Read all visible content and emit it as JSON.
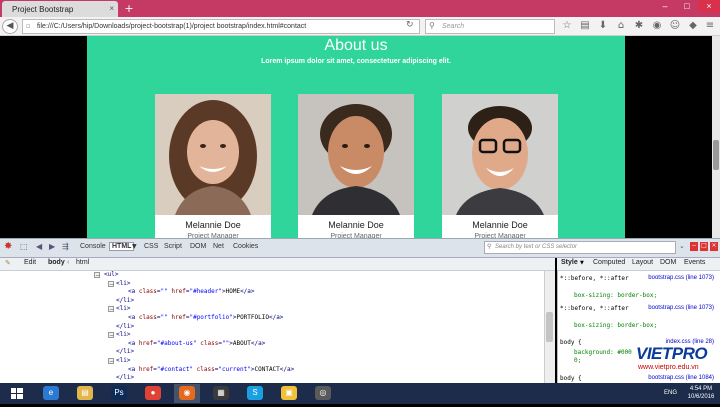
{
  "browser": {
    "tab_title": "Project Bootstrap",
    "tab_close": "×",
    "new_tab": "+",
    "url": "file:///C:/Users/hip/Downloads/project-bootstrap(1)/project bootstrap/index.html#contact",
    "search_placeholder": "Search",
    "window_buttons": [
      "–",
      "□",
      "×"
    ]
  },
  "page": {
    "title": "About us",
    "subtitle": "Lorem ipsum dolor sit amet, consectetuer adipiscing elit.",
    "team": [
      {
        "name": "Melannie Doe",
        "role": "Project Manager"
      },
      {
        "name": "Melannie Doe",
        "role": "Project Manager"
      },
      {
        "name": "Melannie Doe",
        "role": "Project Manager"
      }
    ]
  },
  "firebug": {
    "tabs": [
      "Console",
      "HTML",
      "CSS",
      "Script",
      "DOM",
      "Net",
      "Cookies"
    ],
    "active_tab": "HTML",
    "search_placeholder": "Search by text or CSS selector",
    "edit_label": "Edit",
    "breadcrumb": [
      "body",
      "html"
    ],
    "side_tabs": [
      "Style",
      "Computed",
      "Layout",
      "DOM",
      "Events"
    ],
    "html_lines": [
      {
        "indent": 0,
        "expander": "−",
        "parts": [
          [
            "tag",
            "<ul>"
          ]
        ]
      },
      {
        "indent": 1,
        "expander": "−",
        "parts": [
          [
            "tag",
            "<li>"
          ]
        ]
      },
      {
        "indent": 2,
        "expander": "",
        "parts": [
          [
            "tag",
            "<a "
          ],
          [
            "attr",
            "class"
          ],
          [
            "tag",
            "="
          ],
          [
            "val",
            "\"\""
          ],
          [
            "tag",
            " "
          ],
          [
            "attr",
            "href"
          ],
          [
            "tag",
            "="
          ],
          [
            "val",
            "\"#header\""
          ],
          [
            "tag",
            ">"
          ],
          [
            "txt",
            "HOME"
          ],
          [
            "tag",
            "</a>"
          ]
        ]
      },
      {
        "indent": 1,
        "expander": "",
        "parts": [
          [
            "tag",
            "</li>"
          ]
        ]
      },
      {
        "indent": 1,
        "expander": "−",
        "parts": [
          [
            "tag",
            "<li>"
          ]
        ]
      },
      {
        "indent": 2,
        "expander": "",
        "parts": [
          [
            "tag",
            "<a "
          ],
          [
            "attr",
            "class"
          ],
          [
            "tag",
            "="
          ],
          [
            "val",
            "\"\""
          ],
          [
            "tag",
            " "
          ],
          [
            "attr",
            "href"
          ],
          [
            "tag",
            "="
          ],
          [
            "val",
            "\"#portfolio\""
          ],
          [
            "tag",
            ">"
          ],
          [
            "txt",
            "PORTFOLIO"
          ],
          [
            "tag",
            "</a>"
          ]
        ]
      },
      {
        "indent": 1,
        "expander": "",
        "parts": [
          [
            "tag",
            "</li>"
          ]
        ]
      },
      {
        "indent": 1,
        "expander": "−",
        "parts": [
          [
            "tag",
            "<li>"
          ]
        ]
      },
      {
        "indent": 2,
        "expander": "",
        "parts": [
          [
            "tag",
            "<a "
          ],
          [
            "attr",
            "href"
          ],
          [
            "tag",
            "="
          ],
          [
            "val",
            "\"#about-us\""
          ],
          [
            "tag",
            " "
          ],
          [
            "attr",
            "class"
          ],
          [
            "tag",
            "="
          ],
          [
            "val",
            "\"\""
          ],
          [
            "tag",
            ">"
          ],
          [
            "txt",
            "ABOUT"
          ],
          [
            "tag",
            "</a>"
          ]
        ]
      },
      {
        "indent": 1,
        "expander": "",
        "parts": [
          [
            "tag",
            "</li>"
          ]
        ]
      },
      {
        "indent": 1,
        "expander": "−",
        "parts": [
          [
            "tag",
            "<li>"
          ]
        ]
      },
      {
        "indent": 2,
        "expander": "",
        "parts": [
          [
            "tag",
            "<a "
          ],
          [
            "attr",
            "href"
          ],
          [
            "tag",
            "="
          ],
          [
            "val",
            "\"#contact\""
          ],
          [
            "tag",
            " "
          ],
          [
            "attr",
            "class"
          ],
          [
            "tag",
            "="
          ],
          [
            "val",
            "\"current\""
          ],
          [
            "tag",
            ">"
          ],
          [
            "txt",
            "CONTACT"
          ],
          [
            "tag",
            "</a>"
          ]
        ]
      },
      {
        "indent": 1,
        "expander": "",
        "parts": [
          [
            "tag",
            "</li>"
          ]
        ]
      },
      {
        "indent": 0,
        "expander": "",
        "parts": [
          [
            "tag",
            "</ul>"
          ]
        ]
      }
    ],
    "style_rules": [
      {
        "selector": "*::before, *::after",
        "file": "bootstrap.css (line 1073)",
        "decl": "box-sizing: border-box;"
      },
      {
        "selector": "*::before, *::after",
        "file": "bootstrap.css (line 1073)",
        "decl": "box-sizing: border-box;"
      },
      {
        "selector": "body {",
        "file": "index.css (line 28)",
        "decl": "background: #000",
        "extra": "0;"
      },
      {
        "selector": "body {",
        "file": "bootstrap.css (line 1084)",
        "decl": ""
      }
    ]
  },
  "watermark": {
    "brand": "VIETPRO",
    "site": "www.vietpro.edu.vn"
  },
  "taskbar": {
    "apps": [
      "ie",
      "explorer",
      "photoshop",
      "chrome",
      "firefox",
      "terminal",
      "skype",
      "folder",
      "media"
    ],
    "lang": "ENG",
    "time": "4:54 PM",
    "date": "10/6/2016"
  },
  "colors": {
    "page_bg": "#2fd59a",
    "titlebar": "#c53a64",
    "taskbar": "#1c2c4a"
  }
}
